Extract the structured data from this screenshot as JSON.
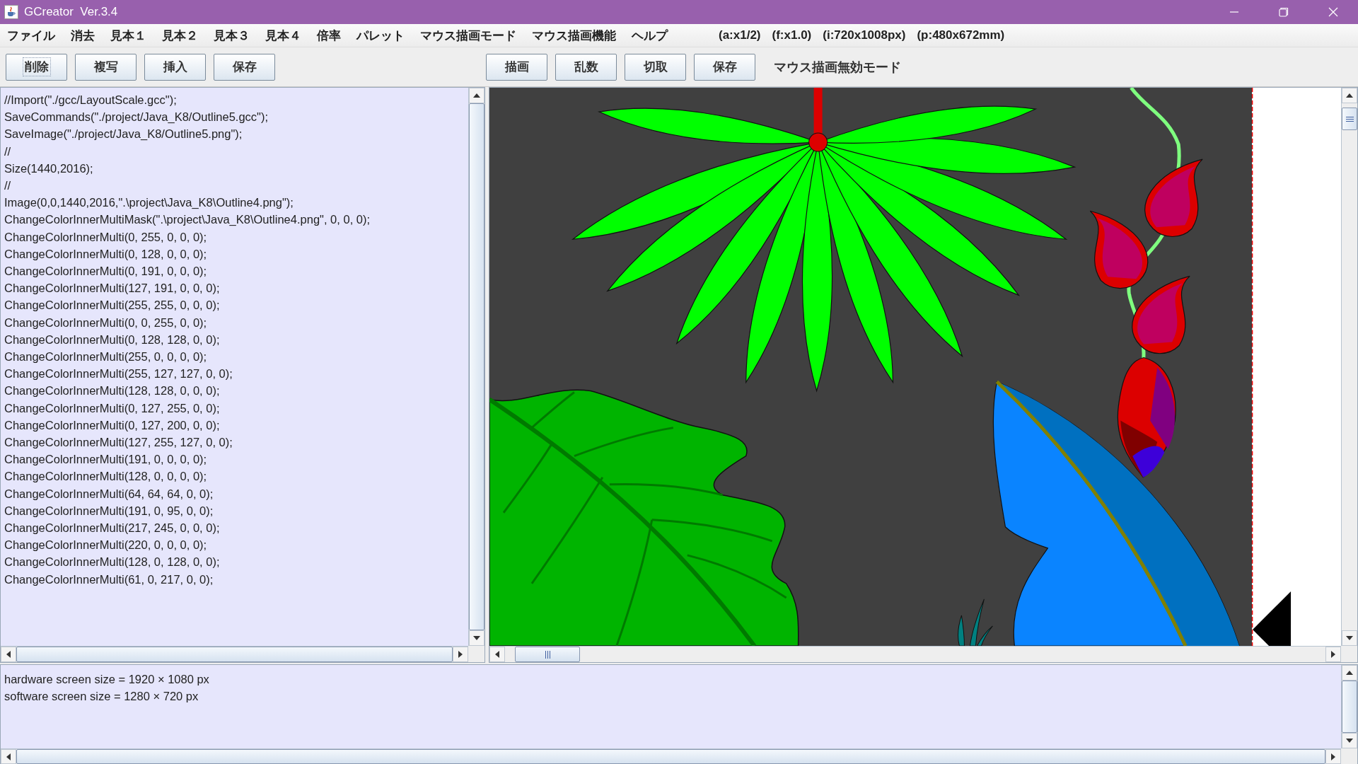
{
  "window": {
    "title": "GCreator  Ver.3.4"
  },
  "menu": [
    "ファイル",
    "消去",
    "見本１",
    "見本２",
    "見本３",
    "見本４",
    "倍率",
    "パレット",
    "マウス描画モード",
    "マウス描画機能",
    "ヘルプ"
  ],
  "readouts": [
    "(a:x1/2)",
    "(f:x1.0)",
    "(i:720x1008px)",
    "(p:480x672mm)"
  ],
  "toolbar_left": [
    {
      "label": "削除",
      "focused": true
    },
    {
      "label": "複写",
      "focused": false
    },
    {
      "label": "挿入",
      "focused": false
    },
    {
      "label": "保存",
      "focused": false
    }
  ],
  "toolbar_right": [
    {
      "label": "描画",
      "focused": false
    },
    {
      "label": "乱数",
      "focused": false
    },
    {
      "label": "切取",
      "focused": false
    },
    {
      "label": "保存",
      "focused": false
    }
  ],
  "mode_label": "マウス描画無効モード",
  "code_lines": [
    "//Import(\"./gcc/LayoutScale.gcc\");",
    "SaveCommands(\"./project/Java_K8/Outline5.gcc\");",
    "SaveImage(\"./project/Java_K8/Outline5.png\");",
    "//",
    "Size(1440,2016);",
    "//",
    "Image(0,0,1440,2016,\".\\project\\Java_K8\\Outline4.png\");",
    "ChangeColorInnerMultiMask(\".\\project\\Java_K8\\Outline4.png\", 0, 0, 0);",
    "ChangeColorInnerMulti(0, 255, 0, 0, 0);",
    "ChangeColorInnerMulti(0, 128, 0, 0, 0);",
    "ChangeColorInnerMulti(0, 191, 0, 0, 0);",
    "ChangeColorInnerMulti(127, 191, 0, 0, 0);",
    "ChangeColorInnerMulti(255, 255, 0, 0, 0);",
    "ChangeColorInnerMulti(0, 0, 255, 0, 0);",
    "ChangeColorInnerMulti(0, 128, 128, 0, 0);",
    "ChangeColorInnerMulti(255, 0, 0, 0, 0);",
    "ChangeColorInnerMulti(255, 127, 127, 0, 0);",
    "ChangeColorInnerMulti(128, 128, 0, 0, 0);",
    "ChangeColorInnerMulti(0, 127, 255, 0, 0);",
    "ChangeColorInnerMulti(0, 127, 200, 0, 0);",
    "ChangeColorInnerMulti(127, 255, 127, 0, 0);",
    "ChangeColorInnerMulti(191, 0, 0, 0, 0);",
    "ChangeColorInnerMulti(128, 0, 0, 0, 0);",
    "ChangeColorInnerMulti(64, 64, 64, 0, 0);",
    "ChangeColorInnerMulti(191, 0, 95, 0, 0);",
    "ChangeColorInnerMulti(217, 245, 0, 0, 0);",
    "ChangeColorInnerMulti(220, 0, 0, 0, 0);",
    "ChangeColorInnerMulti(128, 0, 128, 0, 0);",
    "ChangeColorInnerMulti(61, 0, 217, 0, 0);"
  ],
  "console_lines": [
    "hardware screen size = 1920 × 1080 px",
    "software screen size = 1280 × 720 px"
  ]
}
